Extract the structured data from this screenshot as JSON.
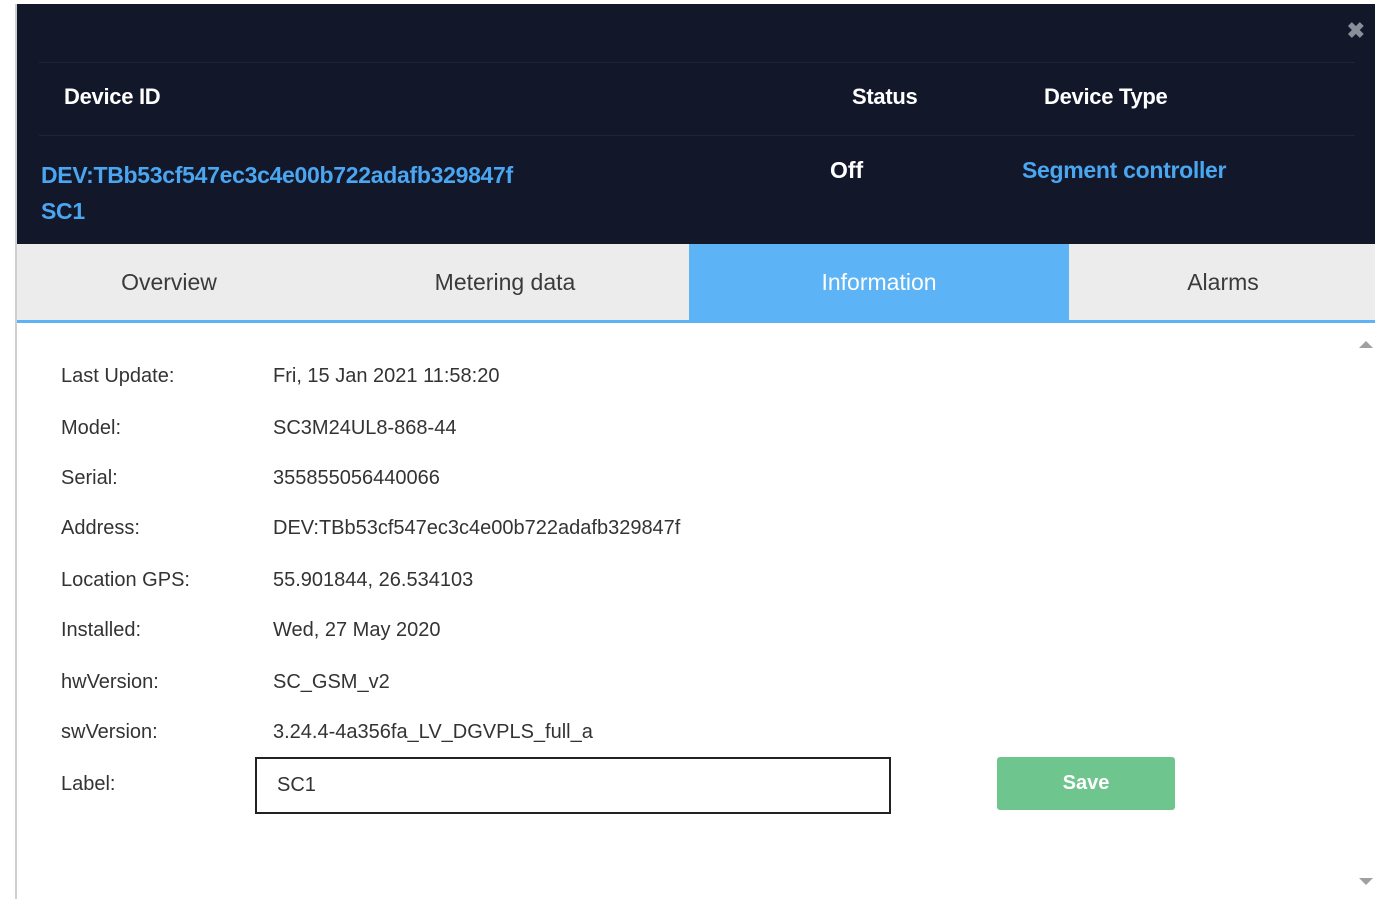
{
  "header": {
    "close_icon": "close-icon",
    "columns": {
      "device_id": "Device ID",
      "status": "Status",
      "device_type": "Device Type"
    },
    "device_id_value": "DEV:TBb53cf547ec3c4e00b722adafb329847f",
    "device_label_value": "SC1",
    "status_value": "Off",
    "device_type_value": "Segment controller"
  },
  "tabs": [
    {
      "label": "Overview",
      "active": false
    },
    {
      "label": "Metering data",
      "active": false
    },
    {
      "label": "Information",
      "active": true
    },
    {
      "label": "Alarms",
      "active": false
    }
  ],
  "info": {
    "fields": [
      {
        "label": "Last Update:",
        "value": "Fri, 15 Jan 2021 11:58:20"
      },
      {
        "label": "Model:",
        "value": "SC3M24UL8-868-44"
      },
      {
        "label": "Serial:",
        "value": "355855056440066"
      },
      {
        "label": "Address:",
        "value": "DEV:TBb53cf547ec3c4e00b722adafb329847f"
      },
      {
        "label": "Location GPS:",
        "value": "55.901844, 26.534103"
      },
      {
        "label": "Installed:",
        "value": "Wed, 27 May 2020"
      },
      {
        "label": "hwVersion:",
        "value": "SC_GSM_v2"
      },
      {
        "label": "swVersion:",
        "value": "3.24.4-4a356fa_LV_DGVPLS_full_a"
      }
    ],
    "label_field": {
      "label": "Label:",
      "value": "SC1"
    },
    "save_label": "Save"
  },
  "colors": {
    "header_bg": "#12172a",
    "accent_blue": "#5cb3f5",
    "link_blue": "#4aa6f0",
    "save_green": "#6fc58e"
  }
}
